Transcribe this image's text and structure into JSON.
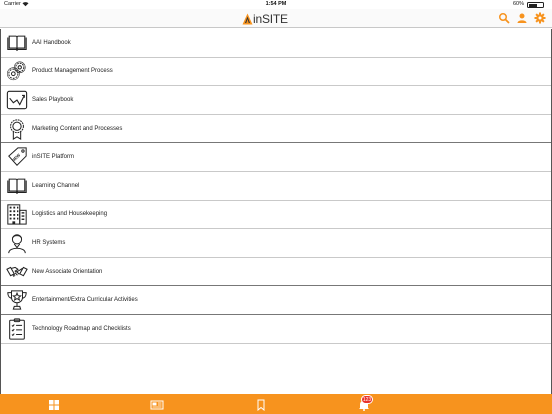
{
  "status_bar": {
    "carrier": "Carrier",
    "time": "1:54 PM",
    "battery": "60%",
    "battery_level": 0.6
  },
  "nav": {
    "logo_text": "inSITE",
    "icons": [
      "search-icon",
      "user-icon",
      "gear-icon"
    ]
  },
  "menu": [
    {
      "label": "AAI Handbook",
      "icon": "book-icon"
    },
    {
      "label": "Product Management Process",
      "icon": "gears-icon"
    },
    {
      "label": "Sales Playbook",
      "icon": "trend-chart-icon"
    },
    {
      "label": "Marketing Content and Processes",
      "icon": "award-ribbon-icon"
    },
    {
      "label": "inSITE Platform",
      "icon": "new-tag-icon"
    },
    {
      "label": "Learning Channel",
      "icon": "book-icon"
    },
    {
      "label": "Logistics and Housekeeping",
      "icon": "building-icon"
    },
    {
      "label": "HR Systems",
      "icon": "person-icon"
    },
    {
      "label": "New Associate Orientation",
      "icon": "handshake-icon"
    },
    {
      "label": "Entertainment/Extra Curricular Activities",
      "icon": "trophy-icon"
    },
    {
      "label": "Technology Roadmap and Checklists",
      "icon": "checklist-icon"
    }
  ],
  "tabs": [
    "grid-icon",
    "news-icon",
    "bookmark-icon",
    "bell-icon"
  ],
  "notification_count": "123",
  "colors": {
    "accent": "#f7931e",
    "badge": "#e8322b"
  }
}
